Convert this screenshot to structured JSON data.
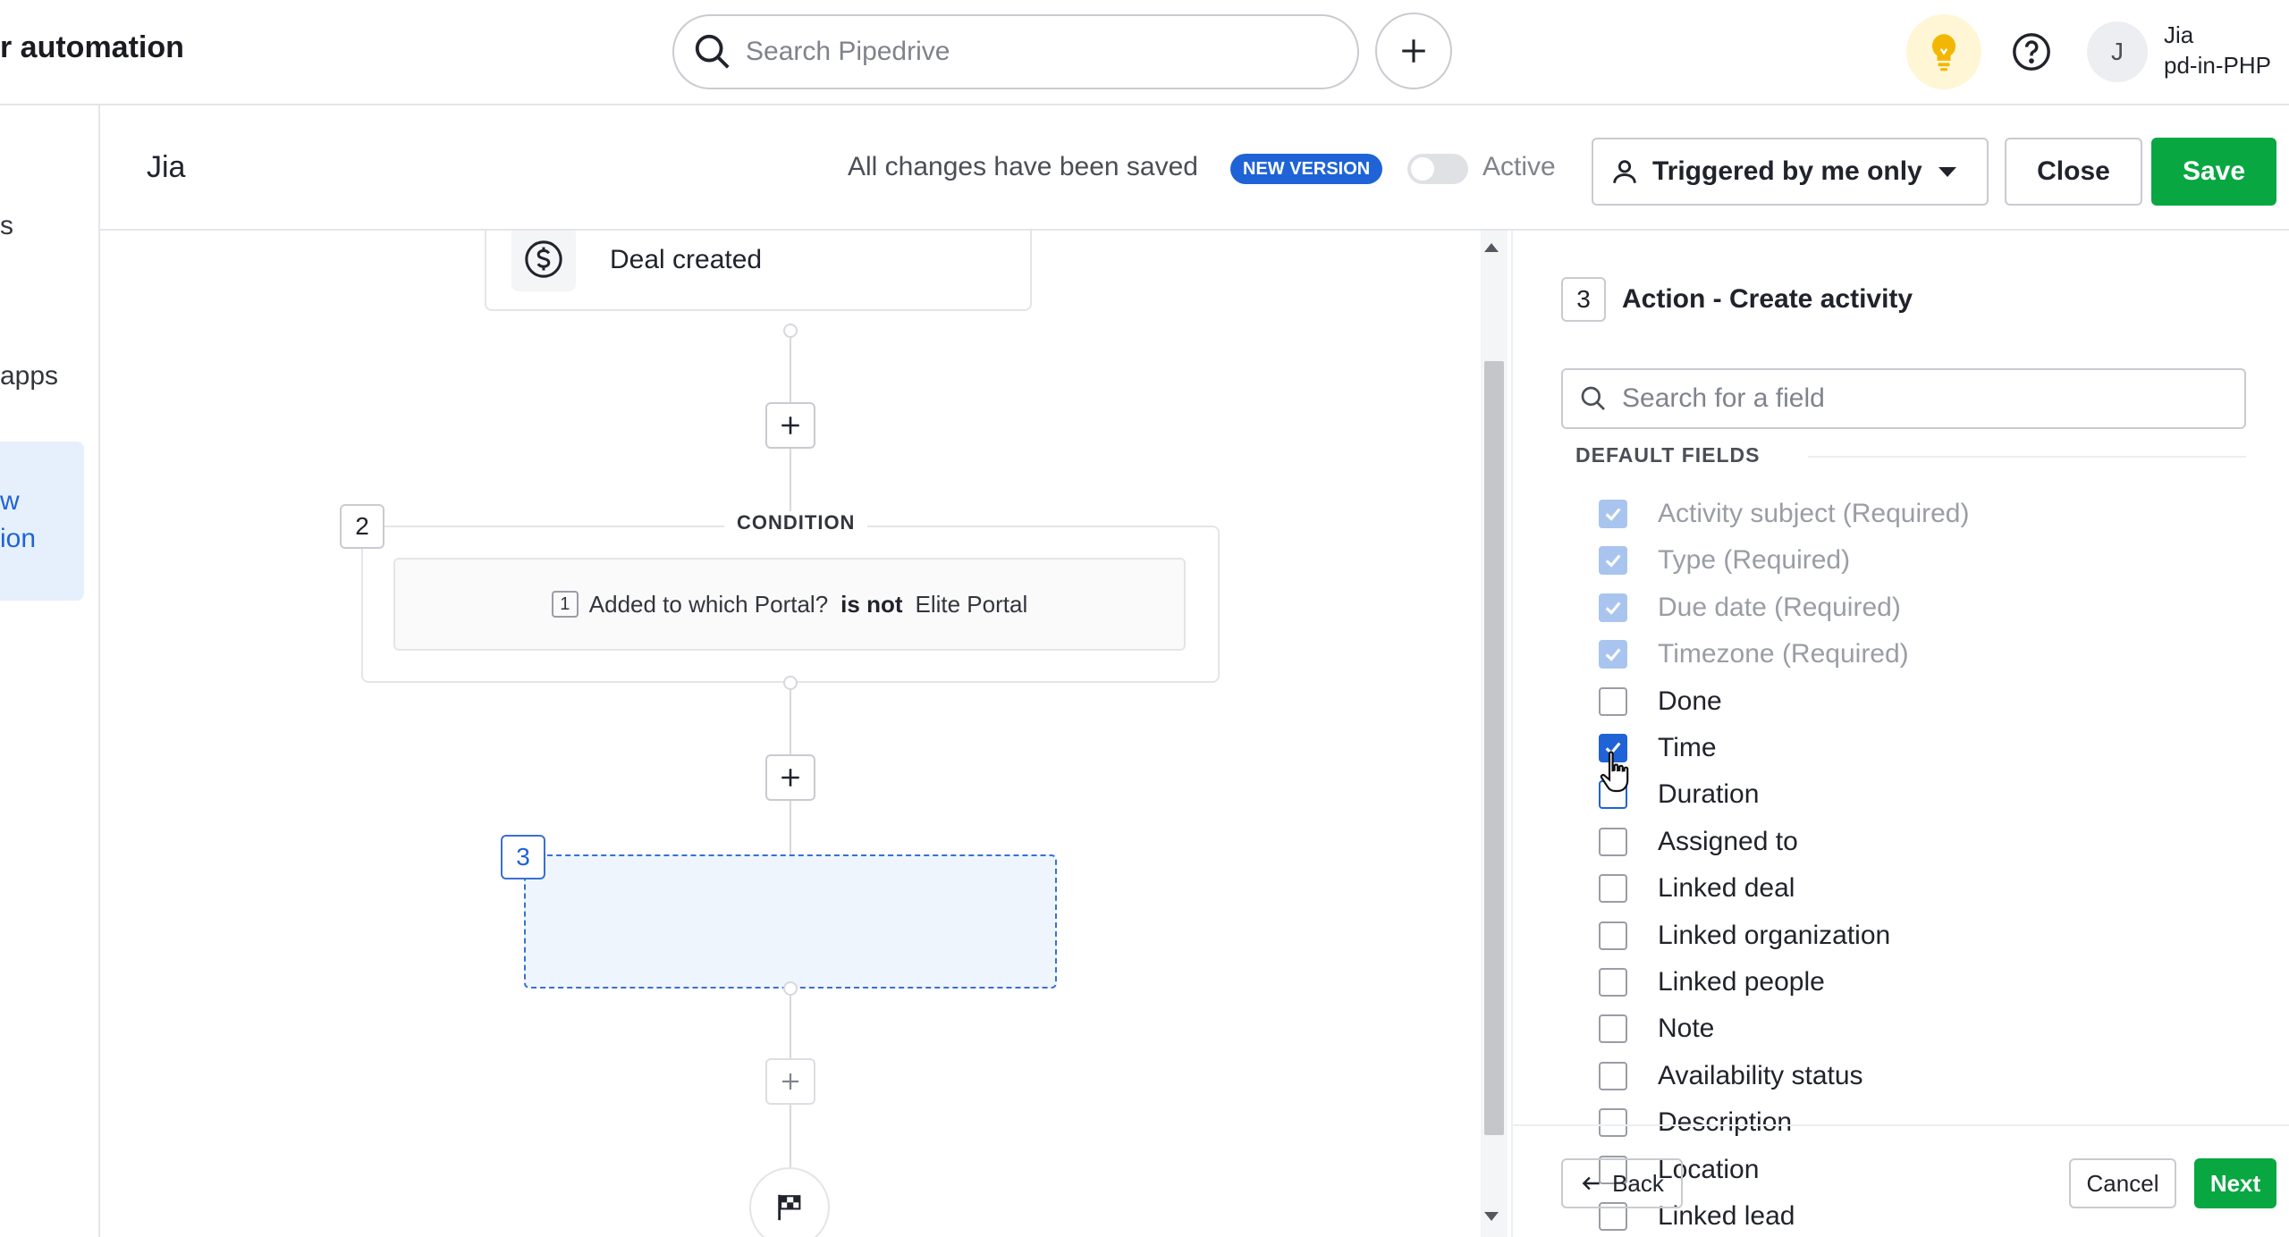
{
  "app": {
    "title": "r automation"
  },
  "search": {
    "placeholder": "Search Pipedrive"
  },
  "user": {
    "initial": "J",
    "name": "Jia",
    "company": "pd-in-PHP"
  },
  "sidebar": {
    "items": [
      {
        "label": "s"
      },
      {
        "label": "apps"
      }
    ],
    "active": {
      "line1": "w",
      "line2": "ion"
    }
  },
  "editor": {
    "workflow_name": "Jia",
    "save_status": "All changes have been saved",
    "version_badge": "NEW VERSION",
    "active_label": "Active",
    "active": false,
    "trigger_scope": "Triggered by me only",
    "close_label": "Close",
    "save_label": "Save"
  },
  "canvas": {
    "trigger": {
      "label": "Deal created",
      "icon": "dollar-circle-icon"
    },
    "condition": {
      "step": "2",
      "tag": "CONDITION",
      "rule_index": "1",
      "field": "Added to which Portal?",
      "operator": "is not",
      "value": "Elite Portal"
    },
    "action": {
      "step": "3"
    }
  },
  "panel": {
    "step": "3",
    "title": "Action - Create activity",
    "search_placeholder": "Search for a field",
    "section_label": "DEFAULT FIELDS",
    "fields": [
      {
        "label": "Activity subject (Required)",
        "state": "required"
      },
      {
        "label": "Type (Required)",
        "state": "required"
      },
      {
        "label": "Due date (Required)",
        "state": "required"
      },
      {
        "label": "Timezone (Required)",
        "state": "required"
      },
      {
        "label": "Done",
        "state": "unchecked"
      },
      {
        "label": "Time",
        "state": "checked"
      },
      {
        "label": "Duration",
        "state": "unchecked"
      },
      {
        "label": "Assigned to",
        "state": "unchecked"
      },
      {
        "label": "Linked deal",
        "state": "unchecked"
      },
      {
        "label": "Linked organization",
        "state": "unchecked"
      },
      {
        "label": "Linked people",
        "state": "unchecked"
      },
      {
        "label": "Note",
        "state": "unchecked"
      },
      {
        "label": "Availability status",
        "state": "unchecked"
      },
      {
        "label": "Description",
        "state": "unchecked"
      },
      {
        "label": "Location",
        "state": "unchecked"
      },
      {
        "label": "Linked lead",
        "state": "unchecked"
      }
    ],
    "back_label": "Back",
    "cancel_label": "Cancel",
    "next_label": "Next"
  },
  "colors": {
    "accent": "#1f63d6",
    "save_green": "#08a742",
    "bulb_bg": "#fff6d6",
    "bulb": "#f2b705"
  }
}
